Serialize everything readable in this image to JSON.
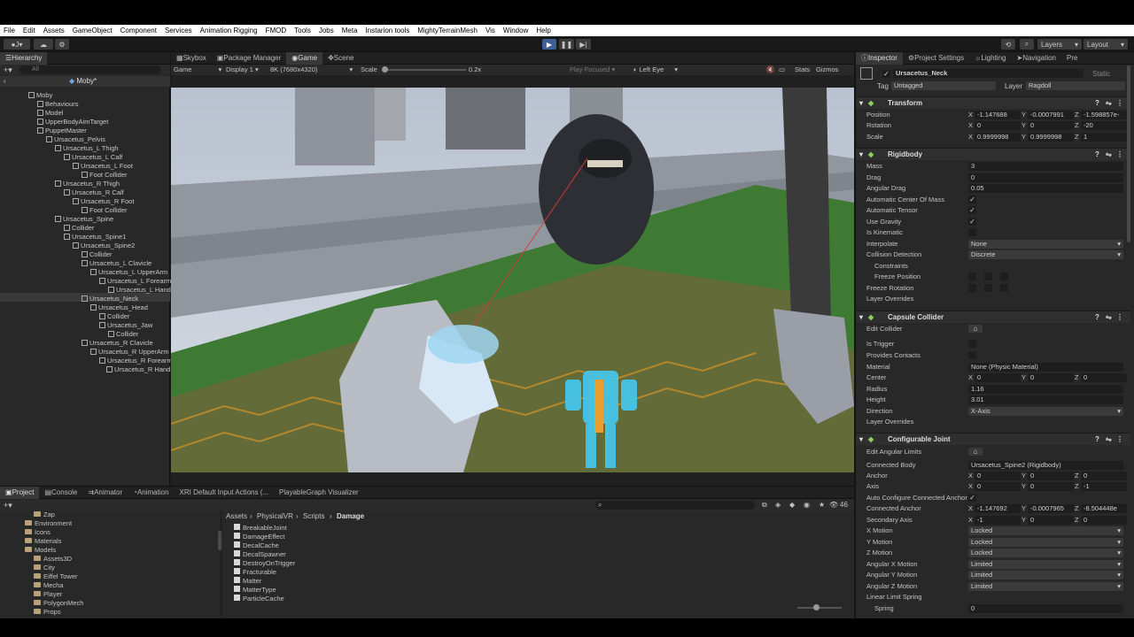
{
  "menu": [
    "File",
    "Edit",
    "Assets",
    "GameObject",
    "Component",
    "Services",
    "Animation Rigging",
    "FMOD",
    "Tools",
    "Jobs",
    "Meta",
    "Instarion tools",
    "MightyTerrainMesh",
    "Vis",
    "Window",
    "Help"
  ],
  "toolbar": {
    "account": "J",
    "layers": "Layers",
    "layout": "Layout"
  },
  "hierarchy": {
    "title": "Hierarchy",
    "search_placeholder": "All",
    "root": "Moby*",
    "items": [
      "Moby",
      "Behaviours",
      "Model",
      "UpperBodyAimTarget",
      "PuppetMaster",
      "Ursacetus_Pelvis",
      "Ursacetus_L Thigh",
      "Ursacetus_L Calf",
      "Ursacetus_L Foot",
      "Foot Collider",
      "Ursacetus_R Thigh",
      "Ursacetus_R Calf",
      "Ursacetus_R Foot",
      "Foot Collider",
      "Ursacetus_Spine",
      "Collider",
      "Ursacetus_Spine1",
      "Ursacetus_Spine2",
      "Collider",
      "Ursacetus_L Clavicle",
      "Ursacetus_L UpperArm",
      "Ursacetus_L Forearm",
      "Ursacetus_L Hand",
      "Ursacetus_Neck",
      "Ursacetus_Head",
      "Collider",
      "Ursacetus_Jaw",
      "Collider",
      "Ursacetus_R Clavicle",
      "Ursacetus_R UpperArm",
      "Ursacetus_R Forearm",
      "Ursacetus_R Hand"
    ]
  },
  "game": {
    "tabs": [
      "Skybox",
      "Package Manager",
      "Game",
      "Scene"
    ],
    "mode": "Game",
    "display": "Display 1",
    "resolution": "8K (7680x4320)",
    "scale_label": "Scale",
    "scale_value": "0.2x",
    "play_focused": "Play Focused",
    "eye": "Left Eye",
    "stats": "Stats",
    "gizmos": "Gizmos"
  },
  "inspector": {
    "tabs": [
      "Inspector",
      "Project Settings",
      "Lighting",
      "Navigation",
      "Pre"
    ],
    "object_name": "Ursacetus_Neck",
    "static_label": "Static",
    "tag_label": "Tag",
    "tag_value": "Untagged",
    "layer_label": "Layer",
    "layer_value": "Ragdoll",
    "transform": {
      "title": "Transform",
      "position": [
        "X",
        "-1.147688",
        "Y",
        "-0.0007991",
        "Z",
        "-1.598857e-"
      ],
      "rotation": [
        "X",
        "0",
        "Y",
        "0",
        "Z",
        "-20"
      ],
      "scale": [
        "X",
        "0.9999998",
        "Y",
        "0.9999998",
        "Z",
        "1"
      ]
    },
    "rigidbody": {
      "title": "Rigidbody",
      "mass": "3",
      "drag": "0",
      "angular_drag": "0.05",
      "interpolate": "None",
      "collision": "Discrete"
    },
    "capsule": {
      "title": "Capsule Collider",
      "material": "None (Physic Material)",
      "center": [
        "X",
        "0",
        "Y",
        "0",
        "Z",
        "0"
      ],
      "radius": "1.16",
      "height": "3.01",
      "direction": "X-Axis"
    },
    "joint": {
      "title": "Configurable Joint",
      "connected_body": "Ursacetus_Spine2 (Rigidbody)",
      "anchor": [
        "X",
        "0",
        "Y",
        "0",
        "Z",
        "0"
      ],
      "axis": [
        "X",
        "0",
        "Y",
        "0",
        "Z",
        "-1"
      ],
      "connected_anchor": [
        "X",
        "-1.147692",
        "Y",
        "-0.0007965",
        "Z",
        "-8.504448e"
      ],
      "secondary_axis": [
        "X",
        "-1",
        "Y",
        "0",
        "Z",
        "0"
      ],
      "x_motion": "Locked",
      "y_motion": "Locked",
      "z_motion": "Locked",
      "ang_x": "Limited",
      "ang_y": "Limited",
      "ang_z": "Limited",
      "spring": "0"
    },
    "labels": [
      "Position",
      "Rotation",
      "Scale",
      "Mass",
      "Drag",
      "Angular Drag",
      "Automatic Center Of Mass",
      "Automatic Tensor",
      "Use Gravity",
      "Is Kinematic",
      "Interpolate",
      "Collision Detection",
      "Constraints",
      "Freeze Position",
      "Freeze Rotation",
      "Layer Overrides",
      "Edit Collider",
      "Is Trigger",
      "Provides Contacts",
      "Material",
      "Center",
      "Radius",
      "Height",
      "Direction",
      "Layer Overrides",
      "Edit Angular Limits",
      "Connected Body",
      "Anchor",
      "Axis",
      "Auto Configure Connected Anchor",
      "Connected Anchor",
      "Secondary Axis",
      "X Motion",
      "Y Motion",
      "Z Motion",
      "Angular X Motion",
      "Angular Y Motion",
      "Angular Z Motion",
      "Linear Limit Spring",
      "Spring"
    ]
  },
  "project": {
    "tabs": [
      "Project",
      "Console",
      "Animator",
      "Animation",
      "XRI Default Input Actions (...",
      "PlayableGraph Visualizer"
    ],
    "breadcrumb": [
      "Assets",
      "PhysicalVR",
      "Scripts",
      "Damage"
    ],
    "count": "46",
    "folders": [
      "Zap",
      "Environment",
      "Icons",
      "Materials",
      "Models",
      "Assets3D",
      "City",
      "Eiffel Tower",
      "Mecha",
      "Player",
      "PolygonMech",
      "Props"
    ],
    "files": [
      "BreakableJoint",
      "DamageEffect",
      "DecalCache",
      "DecalSpawner",
      "DestroyOnTrigger",
      "Fracturable",
      "Matter",
      "MatterType",
      "ParticleCache"
    ]
  }
}
